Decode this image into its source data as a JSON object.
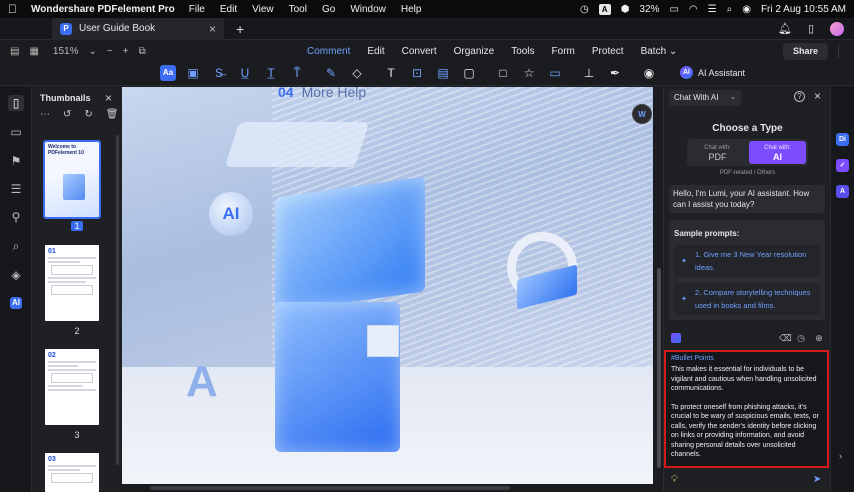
{
  "menubar": {
    "apple": "",
    "app_name": "Wondershare PDFelement Pro",
    "items": [
      "File",
      "Edit",
      "View",
      "Tool",
      "Go",
      "Window",
      "Help"
    ],
    "input_source": "A",
    "battery": "32%",
    "datetime": "Fri 2 Aug 10:55 AM"
  },
  "tabbar": {
    "doc_tab": "User Guide Book",
    "close": "×",
    "new_tab": "+"
  },
  "toolbar": {
    "zoom": "151%",
    "menu": [
      "Comment",
      "Edit",
      "Convert",
      "Organize",
      "Tools",
      "Form",
      "Protect",
      "Batch"
    ],
    "active_menu": "Comment",
    "share": "Share",
    "ai_assistant": "AI Assistant",
    "ai_badge": "AI"
  },
  "thumbnails": {
    "title": "Thumbnails",
    "close": "×",
    "selected_page": "1",
    "pages": [
      {
        "label": "1",
        "heading": "Welcome to PDFelement 10"
      },
      {
        "label": "2",
        "heading": "01"
      },
      {
        "label": "3",
        "heading": "02"
      },
      {
        "label": "",
        "heading": "03"
      }
    ]
  },
  "document": {
    "section_num": "04",
    "section_title": "More Help",
    "ai_text": "AI",
    "letter": "A",
    "float_badge": "W"
  },
  "ai_panel": {
    "mode_select": "Chat With AI",
    "help": "?",
    "close": "×",
    "choose_title": "Choose a Type",
    "options": [
      {
        "top": "Chat with:",
        "main": "PDF"
      },
      {
        "top": "Chat with:",
        "main": "AI"
      }
    ],
    "active_option": "AI",
    "sub_caption": "PDF-related / Others",
    "greeting": "Hello, I'm Lumi, your AI assistant. How can I assist you today?",
    "sample_title": "Sample prompts:",
    "prompts": [
      "1. Give me 3 New Year resolution ideas.",
      "2. Compare storytelling techniques used in books and films."
    ],
    "result_tag": "#Bullet Points",
    "result_paragraphs": [
      "This makes it essential for individuals to be vigilant and cautious when handling unsolicited communications.",
      "To protect oneself from phishing attacks, it's crucial to be wary of suspicious emails, texts, or calls, verify the sender's identity before clicking on links or providing information, and avoid sharing personal details over unsolicited channels."
    ]
  },
  "right_rail": {
    "badges": [
      "Di",
      "✓",
      "A"
    ]
  },
  "colors": {
    "accent": "#3a6df0",
    "ai_purple": "#7c4dff",
    "highlight_red": "#d41a1a"
  }
}
